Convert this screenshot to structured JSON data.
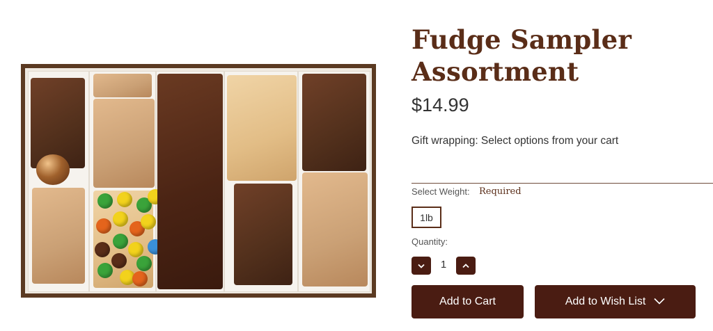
{
  "product": {
    "title": "Fudge Sampler Assortment",
    "price": "$14.99",
    "gift_wrapping": "Gift wrapping: Select options from your cart"
  },
  "weight": {
    "label": "Select Weight:",
    "required": "Required",
    "selected_option": "1lb"
  },
  "quantity": {
    "label": "Quantity:",
    "value": "1",
    "decrement_icon": "chevron-down-icon",
    "increment_icon": "chevron-up-icon"
  },
  "actions": {
    "add_to_cart": "Add to Cart",
    "add_to_wishlist": "Add to Wish List"
  },
  "colors": {
    "brand": "#4a1c12",
    "title": "#5a2d18"
  }
}
